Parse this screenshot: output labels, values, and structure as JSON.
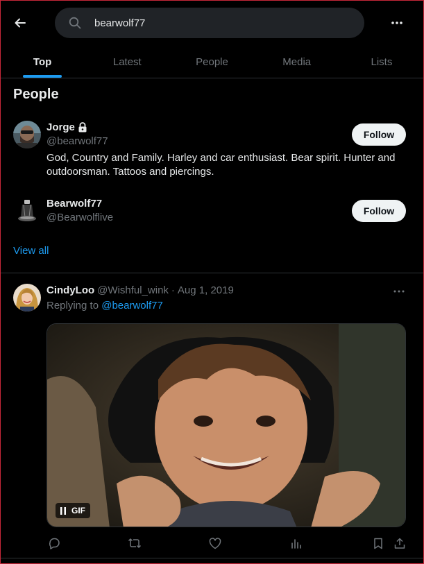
{
  "search": {
    "query": "bearwolf77"
  },
  "tabs": [
    {
      "label": "Top",
      "active": true
    },
    {
      "label": "Latest",
      "active": false
    },
    {
      "label": "People",
      "active": false
    },
    {
      "label": "Media",
      "active": false
    },
    {
      "label": "Lists",
      "active": false
    }
  ],
  "people_section": {
    "heading": "People",
    "users": [
      {
        "name": "Jorge",
        "locked": true,
        "handle": "@bearwolf77",
        "bio": "God, Country and Family. Harley and car enthusiast. Bear spirit. Hunter and outdoorsman. Tattoos and piercings.",
        "follow_label": "Follow"
      },
      {
        "name": "Bearwolf77",
        "locked": false,
        "handle": "@Bearwolflive",
        "bio": "",
        "follow_label": "Follow"
      }
    ],
    "view_all": "View all"
  },
  "tweet": {
    "name": "CindyLoo",
    "handle": "@Wishful_wink",
    "separator": "·",
    "date": "Aug 1, 2019",
    "replying_prefix": "Replying to",
    "replying_to": "@bearwolf77",
    "media_badge": "GIF",
    "actions": [
      "reply-icon",
      "retweet-icon",
      "like-icon",
      "views-icon",
      "bookmark-icon",
      "share-icon"
    ]
  },
  "colors": {
    "background": "#000000",
    "accent": "#1d9bf0",
    "text_primary": "#e7e9ea",
    "text_secondary": "#71767b",
    "divider": "#2f3336",
    "follow_bg": "#eff3f4"
  }
}
